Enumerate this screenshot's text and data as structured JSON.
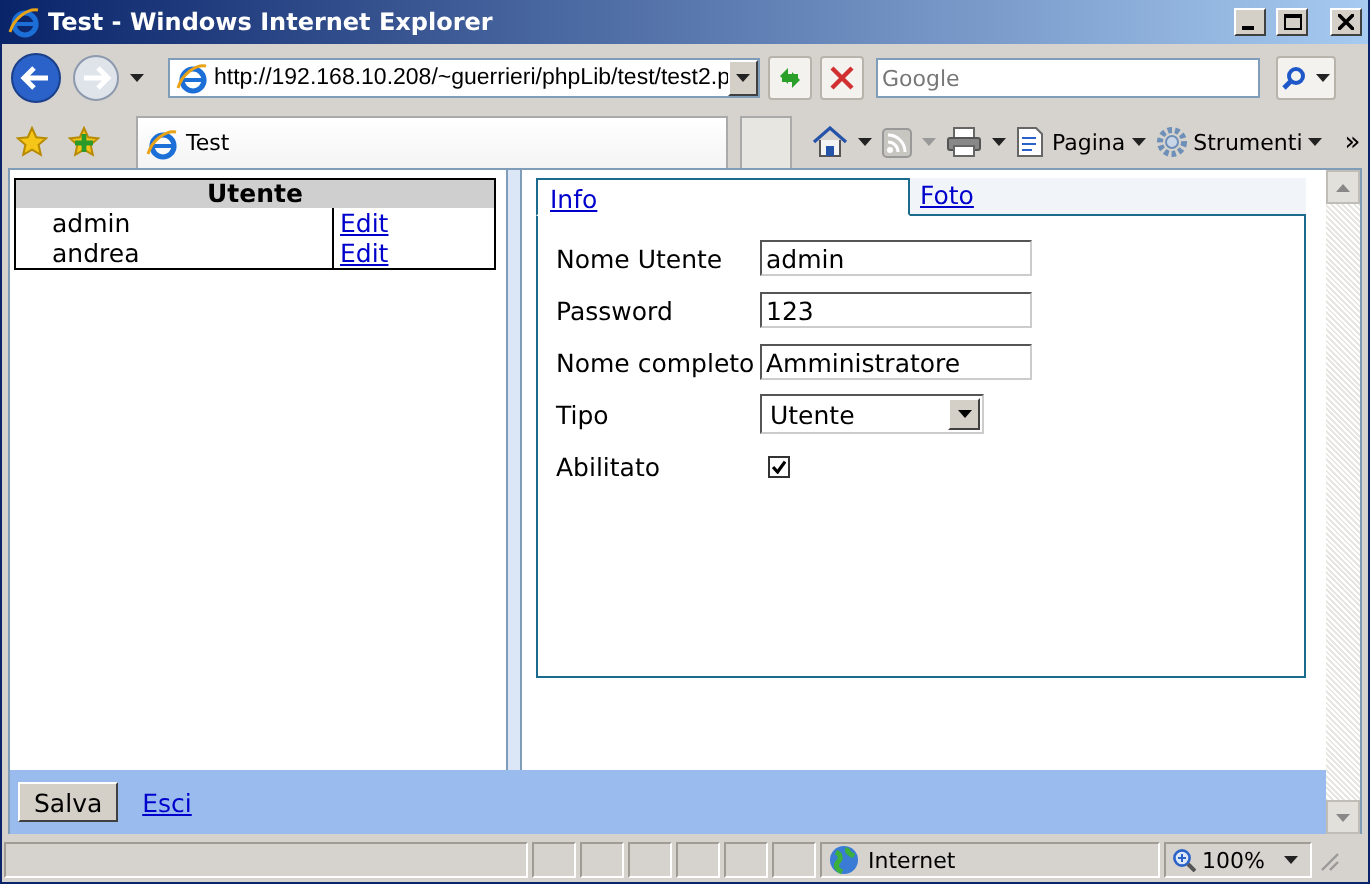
{
  "window": {
    "title": "Test - Windows Internet Explorer"
  },
  "address_bar": {
    "value": "http://192.168.10.208/~guerrieri/phpLib/test/test2.p"
  },
  "search": {
    "placeholder": "Google"
  },
  "browser_tabs": [
    {
      "label": "Test",
      "selected": true
    }
  ],
  "toolbar": [
    {
      "kind": "page",
      "label": "Pagina"
    },
    {
      "kind": "tools",
      "label": "Strumenti"
    }
  ],
  "toolbar_more": "»",
  "users_table": {
    "columns": [
      "Utente"
    ],
    "rows": [
      {
        "name": "admin",
        "action": "Edit"
      },
      {
        "name": "andrea",
        "action": "Edit"
      }
    ]
  },
  "form_tabs": [
    {
      "label": "Info",
      "selected": true
    },
    {
      "label": "Foto",
      "selected": false
    }
  ],
  "fields": [
    {
      "kind": "text",
      "label": "Nome Utente",
      "value": "admin"
    },
    {
      "kind": "text",
      "label": "Password",
      "value": "123"
    },
    {
      "kind": "text",
      "label": "Nome completo",
      "value": "Amministratore"
    },
    {
      "kind": "select",
      "label": "Tipo",
      "value": "Utente"
    },
    {
      "kind": "checkbox",
      "label": "Abilitato",
      "checked": true
    }
  ],
  "actions": {
    "button": "Salva",
    "link": "Esci"
  },
  "status_bar": {
    "zone": "Internet",
    "zoom": "100%"
  }
}
